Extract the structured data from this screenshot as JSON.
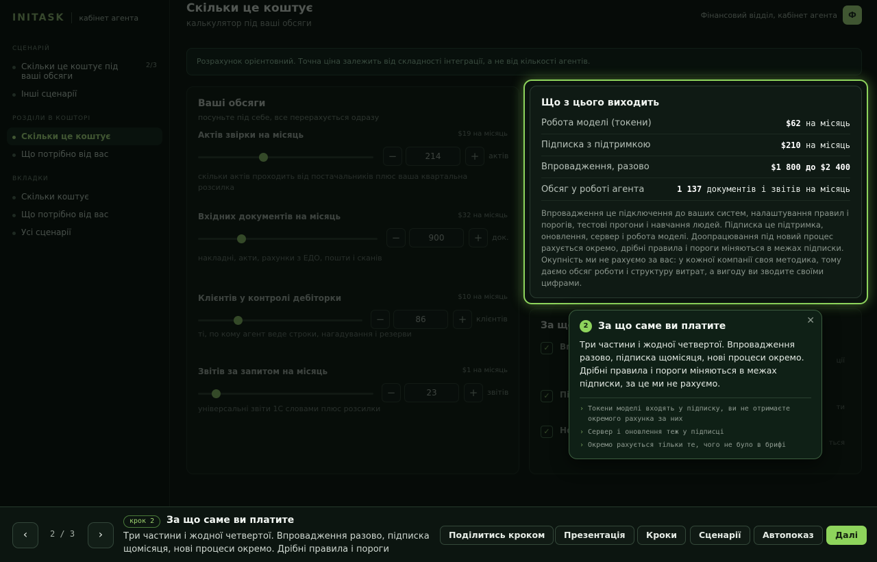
{
  "sidebar": {
    "brand": "INITASK",
    "brand_sub": "кабінет агента",
    "sections": [
      {
        "title": "Сценарій",
        "items": [
          {
            "label": "Скільки це коштує під ваші обсяги",
            "count": "2/3"
          },
          {
            "label": "Інші сценарії",
            "count": ""
          }
        ]
      },
      {
        "title": "Розділи в кошторі",
        "items": [
          {
            "label": "Скільки це коштує",
            "count": ""
          },
          {
            "label": "Що потрібно від вас",
            "count": ""
          }
        ]
      },
      {
        "title": "Вкладки",
        "items": [
          {
            "label": "Скільки коштує",
            "count": ""
          },
          {
            "label": "Що потрібно від вас",
            "count": ""
          },
          {
            "label": "Усі сценарії",
            "count": ""
          }
        ]
      }
    ]
  },
  "header": {
    "title": "Скільки це коштує",
    "subtitle": "калькулятор під ваші обсяги",
    "user_label": "Фінансовий відділ, кабінет агента",
    "avatar": "Ф"
  },
  "banner": "Розрахунок орієнтовний. Точна ціна залежить від складності інтеграції, а не від кількості агентів.",
  "calculator": {
    "title": "Ваші обсяги",
    "subtitle": "посуньте під себе, все перерахується одразу",
    "sliders": [
      {
        "label": "Актів звірки на місяць",
        "price": "$19 на місяць",
        "value": "214",
        "unit": "актів",
        "hint": "скільки актів проходить від постачальників плюс ваша квартальна розсилка",
        "level": 0.37
      },
      {
        "label": "Вхідних документів на місяць",
        "price": "$32 на місяць",
        "value": "900",
        "unit": "док.",
        "hint": "накладні, акти, рахунки з ЕДО, пошти і сканів",
        "level": 0.24
      },
      {
        "label": "Клієнтів у контролі дебіторки",
        "price": "$10 на місяць",
        "value": "86",
        "unit": "клієнтів",
        "hint": "ті, по кому агент веде строки, нагадування і резерви",
        "level": 0.24
      },
      {
        "label": "Звітів за запитом на місяць",
        "price": "$1 на місяць",
        "value": "23",
        "unit": "звітів",
        "hint": "універсальні звіти 1С словами плюс розсилки",
        "level": 0.1
      }
    ]
  },
  "payment_card": {
    "title": "За що",
    "items": [
      {
        "label": "Вп",
        "note": "ції"
      },
      {
        "label": "Пі",
        "note": "ти"
      },
      {
        "label": "Но",
        "note": "ться"
      }
    ],
    "check": "✓"
  },
  "result": {
    "title": "Що з цього виходить",
    "rows": [
      {
        "label": "Робота моделі (токени)",
        "value_bold": "$62",
        "value_rest": " на місяць"
      },
      {
        "label": "Підписка з підтримкою",
        "value_bold": "$210",
        "value_rest": " на місяць"
      },
      {
        "label": "Впровадження, разово",
        "value_bold": "$1 800 до $2 400",
        "value_rest": ""
      },
      {
        "label": "Обсяг у роботі агента",
        "value_bold": "1 137",
        "value_rest": " документів і звітів на місяць"
      }
    ],
    "note": "Впровадження це підключення до ваших систем, налаштування правил і порогів, тестові прогони і навчання людей. Підписка це підтримка, оновлення, сервер і робота моделі. Доопрацювання під новий процес рахується окремо, дрібні правила і пороги міняються в межах підписки. Окупність ми не рахуємо за вас: у кожної компанії своя методика, тому даємо обсяг роботи і структуру витрат, а вигоду ви зводите своїми цифрами."
  },
  "popover": {
    "number": "2",
    "title": "За що саме ви платите",
    "body": "Три частини і жодної четвертої. Впровадження разово, підписка щомісяця, нові процеси окремо. Дрібні правила і пороги міняються в межах підписки, за це ми не рахуємо.",
    "bullets": [
      "Токени моделі входять у підписку, ви не отримаєте окремого рахунка за них",
      "Сервер і оновлення теж у підписці",
      "Окремо рахується тільки те, чого не було в брифі"
    ],
    "close": "✕",
    "bullet_mark": "›"
  },
  "bottom_bar": {
    "prev": "‹",
    "next": "›",
    "counter": "2 / 3",
    "step_tag": "крок 2",
    "title": "За що саме ви платите",
    "description": "Три частини і жодної четвертої. Впровадження разово, підписка щомісяця, нові процеси окремо. Дрібні правила і пороги міняють…",
    "buttons": {
      "share": "Поділитись кроком",
      "presentation": "Презентація",
      "steps": "Кроки",
      "scenarios": "Сценарії",
      "autoplay": "Автопоказ",
      "next": "Далі"
    }
  },
  "colors": {
    "accent": "#8ed45c",
    "background": "#0b130e",
    "card": "#0f1a14"
  }
}
